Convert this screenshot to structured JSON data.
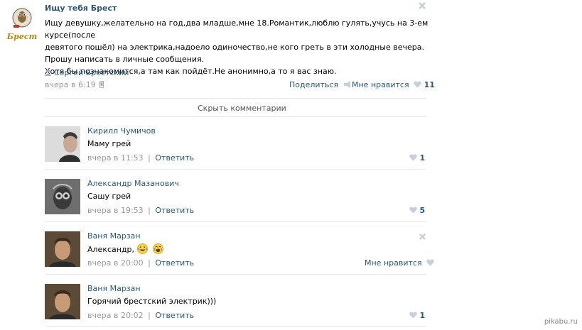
{
  "post": {
    "title": "Ищу тебя Брест",
    "avatar_caption": "Брест",
    "lines": [
      "Ищу девушку,желательно на год,два младше,мне 18.Романтик,люблю гулять,учусь на 3-ем курсе(после",
      "девятого пошёл) на электрика,надоело одиночество,не кого греть в эти холодные вечера.",
      "Прошу написать в личные сообщения.",
      "Хотя бы познакомится,а там как пойдёт.Не анонимно,а то я вас знаю."
    ],
    "author": "Сергей Брестский",
    "time": "вчера в 6:19",
    "share_label": "Поделиться",
    "like_label": "Мне нравится",
    "like_count": "11",
    "hide_comments": "Скрыть комментарии"
  },
  "comments": [
    {
      "name": "Кирилл Чумичов",
      "text": "Маму грей",
      "time": "вчера в 11:53",
      "reply": "Ответить",
      "likes": "1"
    },
    {
      "name": "Александр Мазанович",
      "text": "Сашу грей",
      "time": "вчера в 19:53",
      "reply": "Ответить",
      "likes": "5"
    },
    {
      "name": "Ваня Марзан",
      "text": "Александр,",
      "time": "вчера в 20:00",
      "reply": "Ответить",
      "like_label": "Мне нравится"
    },
    {
      "name": "Ваня Марзан",
      "text": "Горячий брестский электрик)))",
      "time": "вчера в 20:02",
      "reply": "Ответить",
      "likes": "1"
    }
  ],
  "meta_separator": "|",
  "watermark": "pikabu.ru"
}
